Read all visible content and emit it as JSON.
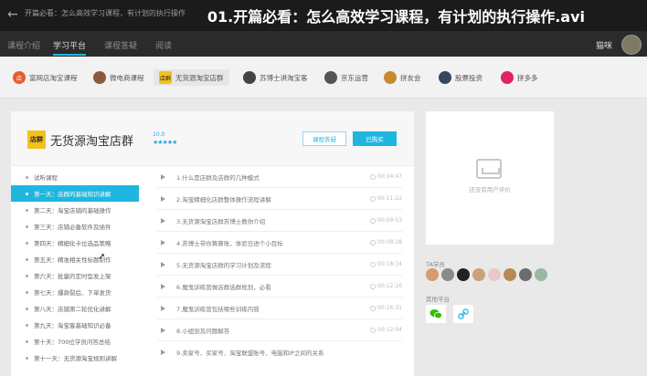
{
  "titlebar": {
    "back": "←",
    "tab_title": "开篇必看：怎么高效学习课程，有计划的执行操作",
    "video_title": "01.开篇必看：怎么高效学习课程，有计划的执行操作.avi"
  },
  "nav": {
    "items": [
      "课程介绍",
      "学习平台",
      "课程答疑",
      "阅读"
    ],
    "active_index": 1,
    "user": "猫咪"
  },
  "categories": [
    {
      "label": "富网店淘宝课程",
      "icon": "shop-icon",
      "color": "#e65c2a"
    },
    {
      "label": "微电商课程",
      "icon": "avatar-icon",
      "color": "#8b5a3c"
    },
    {
      "label": "无货源淘宝店群",
      "icon": "store-group-icon",
      "color": "#f3c11c"
    },
    {
      "label": "苏博士讲淘宝客",
      "icon": "person-icon",
      "color": "#444"
    },
    {
      "label": "京东运营",
      "icon": "person-icon",
      "color": "#555"
    },
    {
      "label": "拼友会",
      "icon": "group-icon",
      "color": "#c78a2e"
    },
    {
      "label": "股票投资",
      "icon": "chart-icon",
      "color": "#36475e"
    },
    {
      "label": "拼多多",
      "icon": "pdd-icon",
      "color": "#e0245e"
    }
  ],
  "course": {
    "logo_text": "店群",
    "name": "无货源淘宝店群",
    "score": "10.0",
    "stars": "★★★★★",
    "btn_qa": "课程答疑",
    "btn_bought": "已购买"
  },
  "chapters": [
    "试听课程",
    "第一天：店群的基础知识讲解",
    "第二天：淘宝店铺的基础操作",
    "第三天：店铺必备软件及插件",
    "第四天：精细化卡位选品策略",
    "第五天：精准相关性标题制作",
    "第六天：批量的定时型发上架",
    "第七天：爆款裂后、下单发货",
    "第八天：店铺第二轮优化讲解",
    "第九天：淘宝客基础知识必备",
    "第十天：700位学员问答总结",
    "第十一天：无货源淘宝规则讲解"
  ],
  "active_chapter": 1,
  "lessons": [
    {
      "title": "1.什么是店群及店群的几种模式",
      "duration": "00:24:47"
    },
    {
      "title": "2.淘宝精细化店群整体操作流程讲解",
      "duration": "00:11:22"
    },
    {
      "title": "3.无货源淘宝店群苏博士教你介绍",
      "duration": "00:09:53"
    },
    {
      "title": "4.苏博士带你算算账，体验日进个小目标",
      "duration": "00:08:28"
    },
    {
      "title": "5.无货源淘宝店群的学习计划及流程",
      "duration": "00:18:34"
    },
    {
      "title": "6.魔鬼训练营做店群选群规划，必看",
      "duration": "00:12:16"
    },
    {
      "title": "7.魔鬼训练营包括哪些训练内容",
      "duration": "00:16:31"
    },
    {
      "title": "8.小组划及问题解答",
      "duration": "00:12:04"
    },
    {
      "title": "9.卖家号、买家号、淘宝联盟账号、电脑和IP之间的关系",
      "duration": ""
    }
  ],
  "sidebar": {
    "empty_text": "还没有用户评价",
    "learners_label": "TA学员",
    "learner_colors": [
      "#d89a6e",
      "#8a8a8a",
      "#222222",
      "#caa27a",
      "#e8c8c8",
      "#b38a52",
      "#6c6c6c",
      "#9bb7a2"
    ],
    "other_label": "其他平台",
    "platforms": [
      {
        "icon": "wechat-icon",
        "color": "#2dc100"
      },
      {
        "icon": "link-icon",
        "color": "#1fb6e0"
      }
    ]
  }
}
